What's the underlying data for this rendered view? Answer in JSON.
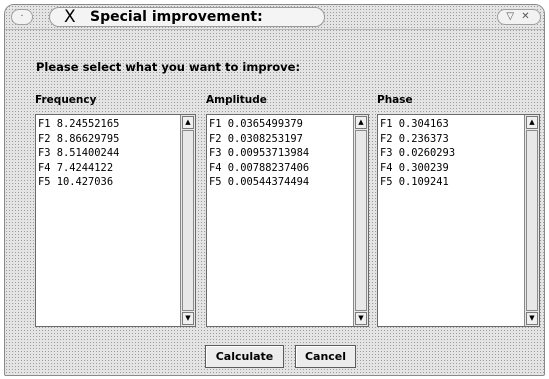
{
  "window": {
    "title": "Special improvement:",
    "logo_glyph": "X",
    "menu_glyph": "·",
    "controls_glyph": "▽ ✕"
  },
  "prompt": "Please select what you want to improve:",
  "columns": [
    {
      "label": "Frequency",
      "items": [
        "F1  8.24552165",
        "F2  8.86629795",
        "F3  8.51400244",
        "F4  7.4244122",
        "F5  10.427036"
      ]
    },
    {
      "label": "Amplitude",
      "items": [
        "F1  0.0365499379",
        "F2  0.0308253197",
        "F3  0.00953713984",
        "F4  0.00788237406",
        "F5  0.00544374494"
      ]
    },
    {
      "label": "Phase",
      "items": [
        "F1  0.304163",
        "F2  0.236373",
        "F3  0.0260293",
        "F4  0.300239",
        "F5  0.109241"
      ]
    }
  ],
  "scroll_up_glyph": "▲",
  "scroll_down_glyph": "▼",
  "buttons": {
    "calculate": "Calculate",
    "cancel": "Cancel"
  }
}
